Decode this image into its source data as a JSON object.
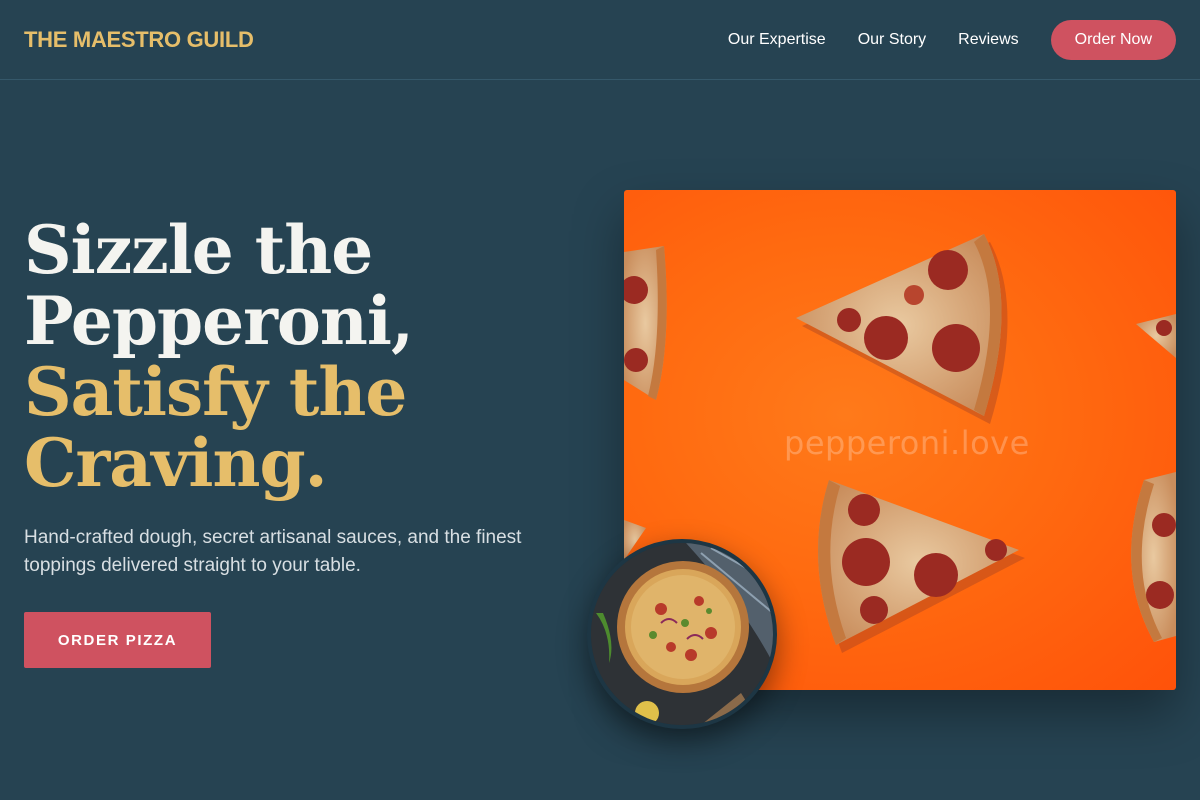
{
  "nav": {
    "brand": "THE MAESTRO GUILD",
    "links": [
      "Our Expertise",
      "Our Story",
      "Reviews"
    ],
    "cta_label": "Order Now"
  },
  "hero": {
    "headline_white": [
      "Sizzle the",
      "Pepperoni,"
    ],
    "headline_gold": [
      "Satisfy the",
      "Craving."
    ],
    "subtext": "Hand-crafted dough, secret artisanal sauces, and the finest toppings delivered straight to your table.",
    "cta_label": "ORDER PIZZA",
    "image_watermark": "pepperoni.love"
  },
  "colors": {
    "background": "#264352",
    "accent_gold": "#e6be6a",
    "accent_red": "#cf5260",
    "image_orange": "#ff6a10"
  }
}
